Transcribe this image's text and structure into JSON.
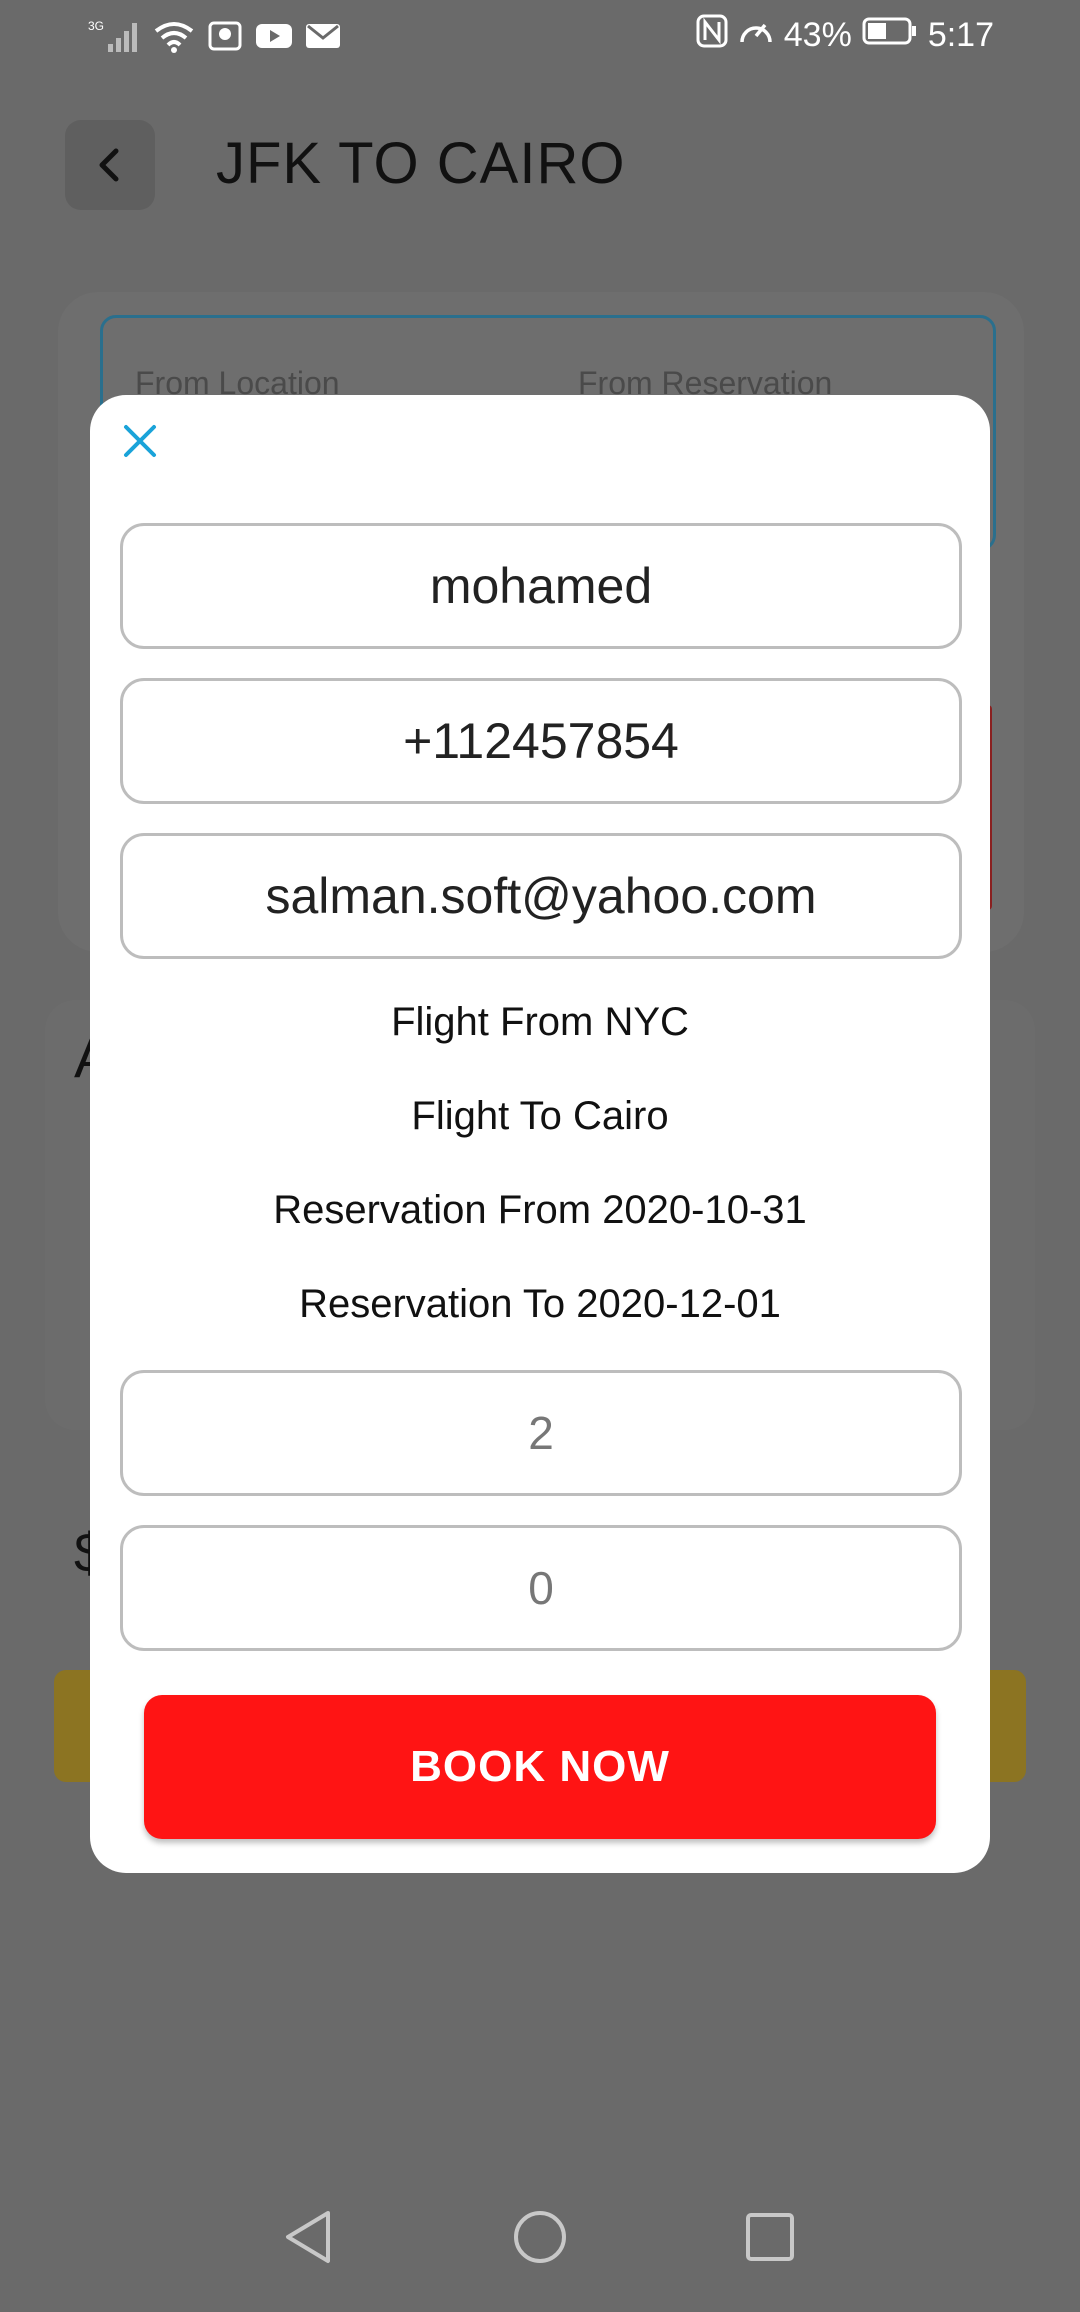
{
  "status_bar": {
    "network": "3G",
    "battery": "43%",
    "time": "5:17",
    "icons": [
      "signal-icon",
      "wifi-icon",
      "notification-icon",
      "youtube-icon",
      "mail-icon",
      "nfc-icon",
      "speed-icon",
      "battery-icon"
    ]
  },
  "header": {
    "title": "JFK TO CAIRO"
  },
  "background": {
    "from_location_label": "From Location",
    "from_reservation_label": "From Reservation",
    "partial_letter_1": "A",
    "partial_letter_2": "$"
  },
  "dialog": {
    "name_value": "mohamed",
    "phone_value": "+112457854",
    "email_value": "salman.soft@yahoo.com",
    "flight_from": "Flight From NYC",
    "flight_to": "Flight To Cairo",
    "reservation_from": "Reservation From 2020-10-31",
    "reservation_to": "Reservation To 2020-12-01",
    "count_1_placeholder": "2",
    "count_2_placeholder": "0",
    "book_label": "BOOK NOW"
  },
  "colors": {
    "accent": "#1aa3d9",
    "book_button": "#ff1414",
    "overlay_bg": "#6a6a6a"
  }
}
